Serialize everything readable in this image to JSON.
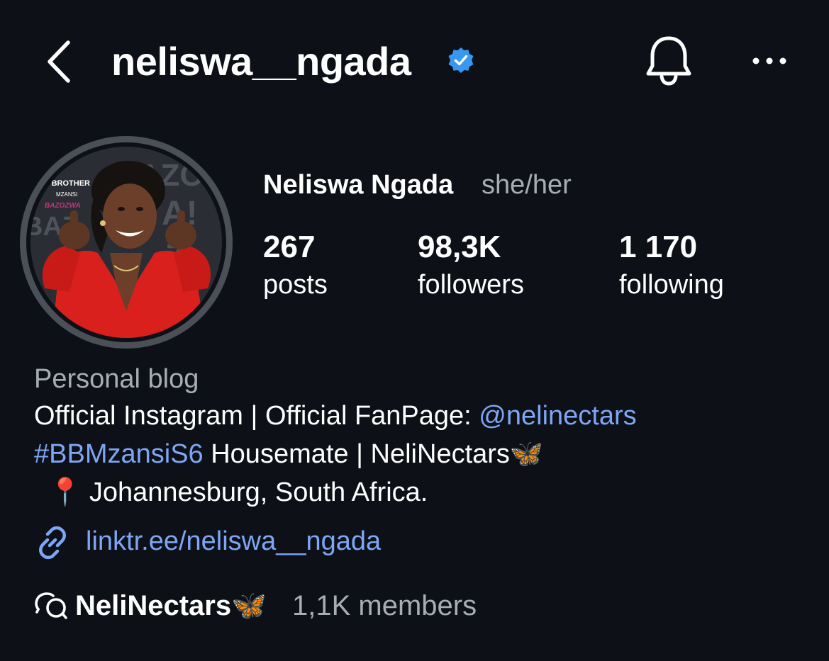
{
  "header": {
    "username": "neliswa__ngada",
    "verified_color": "#3897f0"
  },
  "profile": {
    "full_name": "Neliswa Ngada",
    "pronouns": "she/her"
  },
  "stats": [
    {
      "value": "267",
      "label": "posts"
    },
    {
      "value": "98,3K",
      "label": "followers"
    },
    {
      "value": "1 170",
      "label": "following"
    }
  ],
  "bio": {
    "category": "Personal blog",
    "line1_text": "Official Instagram | Official FanPage: ",
    "line1_mention": "@nelinectars",
    "line2_hashtag": "#BBMzansiS6",
    "line2_text": " Housemate | NeliNectars",
    "line2_emoji": "🦋",
    "line3_emoji": "📍",
    "line3_text": "Johannesburg, South Africa.",
    "link": "linktr.ee/neliswa__ngada"
  },
  "channel": {
    "name": "NeliNectars",
    "emoji": "🦋",
    "members": "1,1K members"
  },
  "avatar_logo": {
    "line1": "G BROTHER",
    "line2": "MZANSI",
    "line3": "BAZOZWA",
    "bg_text": "BAZOZWA!"
  },
  "colors": {
    "background": "#0d1117",
    "link": "#7ea6f5",
    "muted": "#a8adb5",
    "avatar_dress": "#d9201c"
  }
}
